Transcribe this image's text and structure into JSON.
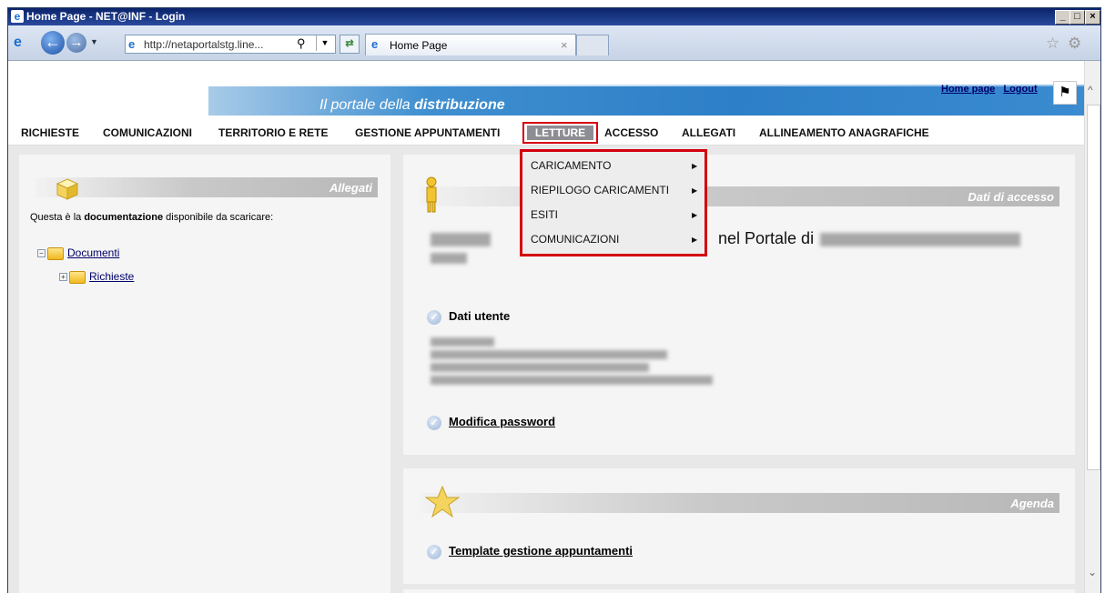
{
  "window": {
    "title": "Home Page - NET@INF - Login",
    "minimize": "_",
    "maximize": "□",
    "close": "×"
  },
  "browser": {
    "address": "http://netaportalstg.line...",
    "tab_title": "Home Page",
    "tab_close": "×"
  },
  "banner": {
    "tagline_prefix": "Il portale della ",
    "tagline_bold": "distribuzione",
    "home_link": "Home page",
    "logout_link": "Logout"
  },
  "nav": {
    "items": [
      "RICHIESTE",
      "COMUNICAZIONI",
      "TERRITORIO E RETE",
      "GESTIONE APPUNTAMENTI",
      "LETTURE",
      "ACCESSO",
      "ALLEGATI",
      "ALLINEAMENTO ANAGRAFICHE"
    ]
  },
  "dropdown": {
    "items": [
      "CARICAMENTO",
      "RIEPILOGO CARICAMENTI",
      "ESITI",
      "COMUNICAZIONI"
    ],
    "arrow": "▶"
  },
  "allegati": {
    "title": "Allegati",
    "desc_prefix": "Questa è la ",
    "desc_bold": "documentazione",
    "desc_suffix": " disponibile da scaricare:",
    "tree": [
      {
        "label": "Documenti",
        "toggle": "−"
      },
      {
        "label": "Richieste",
        "toggle": "+"
      }
    ]
  },
  "accesso": {
    "title": "Dati di accesso",
    "welcome_visible": "nel Portale di",
    "dati_utente": "Dati utente",
    "modifica_password": "Modifica password"
  },
  "agenda": {
    "title": "Agenda",
    "template_link": "Template gestione appuntamenti"
  },
  "colors": {
    "highlight_red": "#d4000f",
    "link_navy": "#00006b",
    "banner_blue": "#2d7fc7"
  }
}
